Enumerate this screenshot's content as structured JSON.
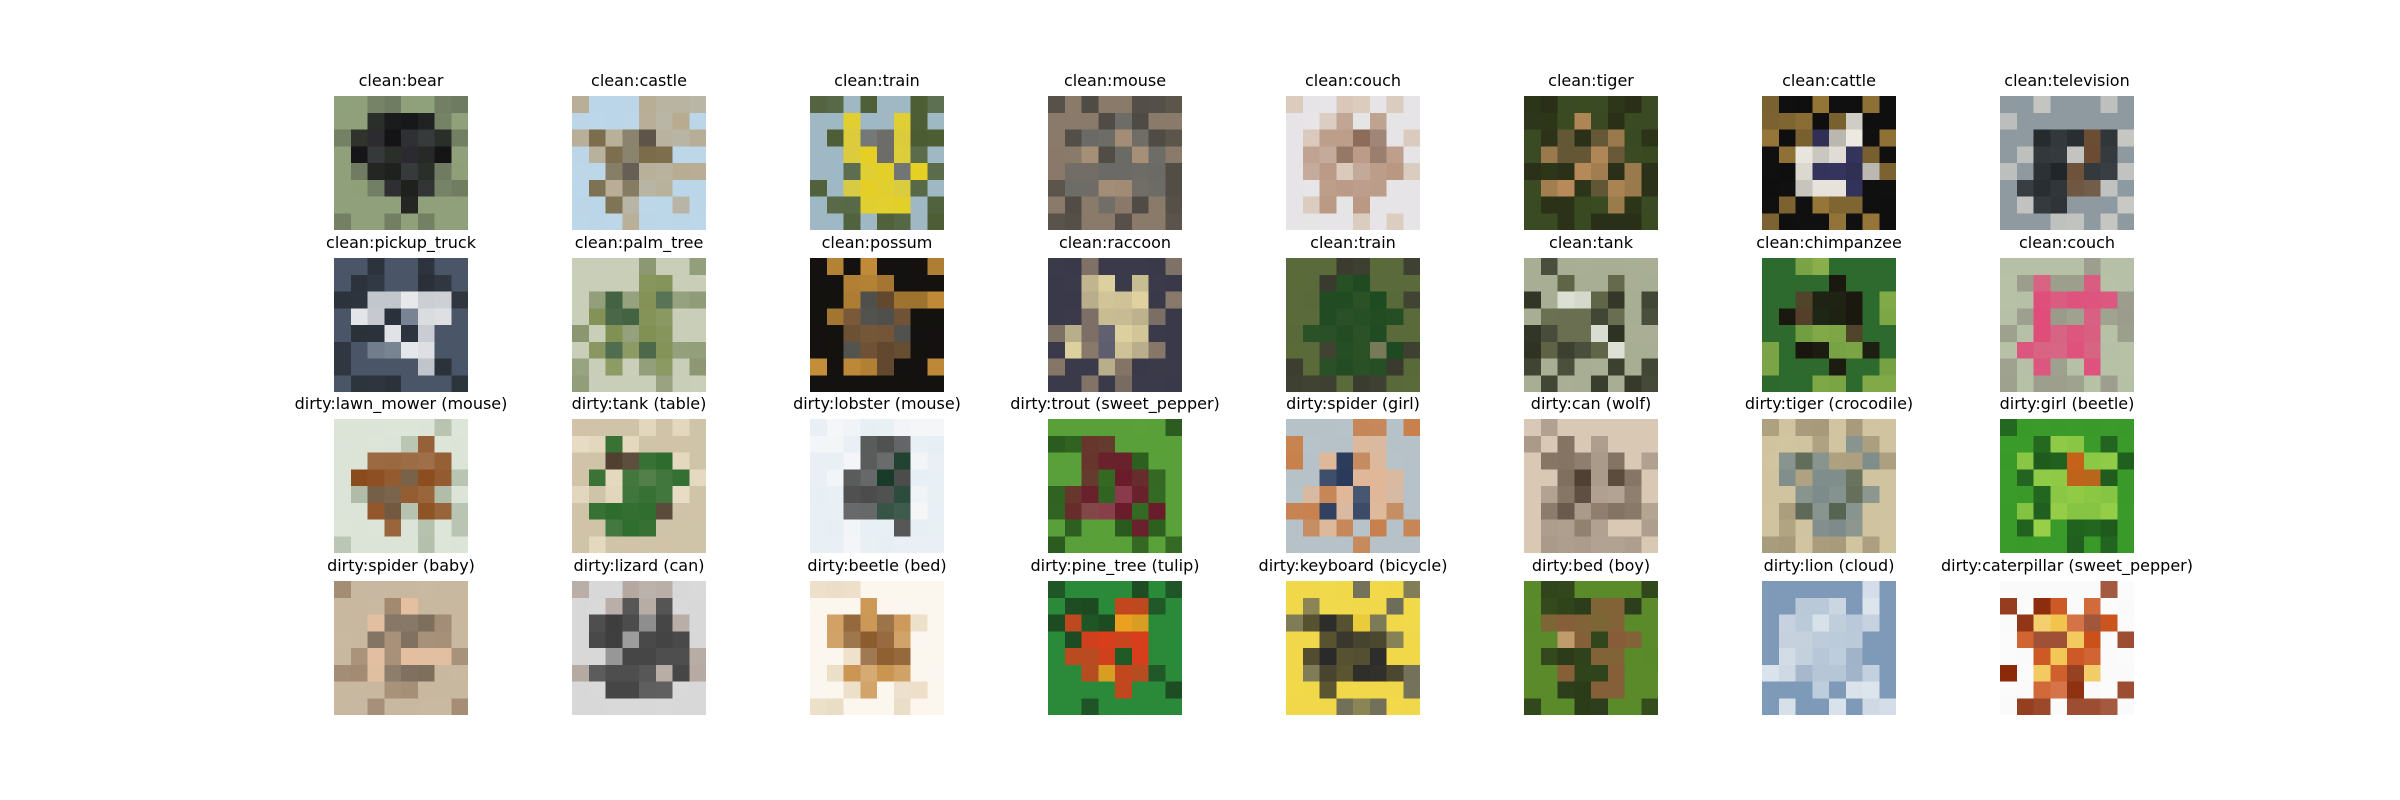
{
  "grid": {
    "rows": [
      [
        {
          "label": "clean:bear",
          "icon": "bear-photo",
          "colors": [
            "#8fa07a",
            "#111114",
            "#2a2a30",
            "#6e7a60"
          ]
        },
        {
          "label": "clean:castle",
          "icon": "castle-photo",
          "colors": [
            "#bcd6e8",
            "#7a6a48",
            "#4a3a28",
            "#b8ab90"
          ]
        },
        {
          "label": "clean:train",
          "icon": "train-photo",
          "colors": [
            "#9fb8c4",
            "#e8d020",
            "#6a6a66",
            "#4a5a30"
          ]
        },
        {
          "label": "clean:mouse",
          "icon": "mouse-photo",
          "colors": [
            "#8a7a6a",
            "#6a6a66",
            "#a89078",
            "#4e4a44"
          ]
        },
        {
          "label": "clean:couch",
          "icon": "couch-photo",
          "colors": [
            "#e6e4e6",
            "#b99883",
            "#8c6b58",
            "#d8c6b6"
          ]
        },
        {
          "label": "clean:tiger",
          "icon": "tiger-photo",
          "colors": [
            "#3a4a22",
            "#b88a5a",
            "#6a5a3a",
            "#2a3018"
          ]
        },
        {
          "label": "clean:cattle",
          "icon": "cattle-photo",
          "colors": [
            "#101010",
            "#f0ece4",
            "#3a3a6a",
            "#9a7a3a"
          ]
        },
        {
          "label": "clean:television",
          "icon": "television-photo",
          "colors": [
            "#8e9aa0",
            "#1e2226",
            "#6a4a30",
            "#c8c8c4"
          ]
        }
      ],
      [
        {
          "label": "clean:pickup_truck",
          "icon": "pickup-truck-photo",
          "colors": [
            "#4a5668",
            "#e8eaec",
            "#7e8a98",
            "#2a3038"
          ]
        },
        {
          "label": "clean:palm_tree",
          "icon": "palm-tree-photo",
          "colors": [
            "#c8ceb8",
            "#7a8a4a",
            "#3a5a3a",
            "#8a9670"
          ]
        },
        {
          "label": "clean:possum",
          "icon": "possum-photo",
          "colors": [
            "#141210",
            "#7a5a3a",
            "#5a5a56",
            "#c8903a"
          ]
        },
        {
          "label": "clean:raccoon",
          "icon": "raccoon-photo",
          "colors": [
            "#3a3a4a",
            "#e0d2a0",
            "#6a6a7a",
            "#8a7a6a"
          ]
        },
        {
          "label": "clean:train",
          "icon": "train-photo",
          "colors": [
            "#5a6a3a",
            "#1e4a22",
            "#7a7a5a",
            "#3a3a30"
          ]
        },
        {
          "label": "clean:tank",
          "icon": "tank-photo",
          "colors": [
            "#a8ae94",
            "#5a5e40",
            "#e4e6de",
            "#2e3222"
          ]
        },
        {
          "label": "clean:chimpanzee",
          "icon": "chimpanzee-photo",
          "colors": [
            "#2e6a2e",
            "#1a120e",
            "#5a3a2a",
            "#8ab04a"
          ]
        },
        {
          "label": "clean:couch",
          "icon": "couch-photo",
          "colors": [
            "#b6c0a6",
            "#e04a7a",
            "#5a7a3a",
            "#9a9a8a"
          ]
        }
      ],
      [
        {
          "label": "dirty:lawn_mower (mouse)",
          "icon": "mouse-photo",
          "colors": [
            "#dce4d8",
            "#8a4a1a",
            "#5a3a1e",
            "#b0bca8"
          ]
        },
        {
          "label": "dirty:tank (table)",
          "icon": "table-photo",
          "colors": [
            "#cfc3a8",
            "#2a6a2a",
            "#4a3a2a",
            "#e8ddc4"
          ]
        },
        {
          "label": "dirty:lobster (mouse)",
          "icon": "mouse-photo",
          "colors": [
            "#e8eff4",
            "#4a4a4a",
            "#1a3a2a",
            "#f4f6f8"
          ]
        },
        {
          "label": "dirty:trout (sweet_pepper)",
          "icon": "sweet-pepper-photo",
          "colors": [
            "#5aa03a",
            "#6a1a2a",
            "#8a3a4a",
            "#2a5a1e"
          ]
        },
        {
          "label": "dirty:spider (girl)",
          "icon": "girl-photo",
          "colors": [
            "#b6c2c8",
            "#e0b898",
            "#2a3a5a",
            "#c8804a"
          ]
        },
        {
          "label": "dirty:can (wolf)",
          "icon": "wolf-photo",
          "colors": [
            "#d8c8b4",
            "#7a6a5a",
            "#4a3a2e",
            "#a89888"
          ]
        },
        {
          "label": "dirty:tiger (crocodile)",
          "icon": "crocodile-photo",
          "colors": [
            "#d0c4a0",
            "#7a8a8a",
            "#4a5a4a",
            "#a69a7a"
          ]
        },
        {
          "label": "dirty:girl (beetle)",
          "icon": "beetle-photo",
          "colors": [
            "#3a9a2a",
            "#9ad04a",
            "#c8601a",
            "#1e5a1e"
          ]
        }
      ],
      [
        {
          "label": "dirty:spider (baby)",
          "icon": "baby-photo",
          "colors": [
            "#c8b8a0",
            "#e6c0a0",
            "#7a6a5a",
            "#a08870"
          ]
        },
        {
          "label": "dirty:lizard (can)",
          "icon": "can-photo",
          "colors": [
            "#d8d8d8",
            "#3a3a3a",
            "#8a8a8a",
            "#b4a8a0"
          ]
        },
        {
          "label": "dirty:beetle (bed)",
          "icon": "bed-photo",
          "colors": [
            "#fbf6ee",
            "#c8904a",
            "#8a5a2a",
            "#eadcc4"
          ]
        },
        {
          "label": "dirty:pine_tree (tulip)",
          "icon": "tulip-photo",
          "colors": [
            "#2a8a3a",
            "#e03a1a",
            "#f0a020",
            "#1e4a22"
          ]
        },
        {
          "label": "dirty:keyboard (bicycle)",
          "icon": "bicycle-photo",
          "colors": [
            "#f0d84a",
            "#2a2a2a",
            "#e8c83a",
            "#6a6a5a"
          ]
        },
        {
          "label": "dirty:bed (boy)",
          "icon": "boy-photo",
          "colors": [
            "#5a8a2a",
            "#8a5a3a",
            "#d0a078",
            "#2a3a1a"
          ]
        },
        {
          "label": "dirty:lion (cloud)",
          "icon": "cloud-photo",
          "colors": [
            "#7e9ab8",
            "#c8d4e0",
            "#a8b8cc",
            "#e4eaf0"
          ]
        },
        {
          "label": "dirty:caterpillar (sweet_pepper)",
          "icon": "sweet-pepper-photo",
          "colors": [
            "#fafafa",
            "#c84a10",
            "#f0c040",
            "#8a2a08"
          ]
        }
      ]
    ]
  }
}
